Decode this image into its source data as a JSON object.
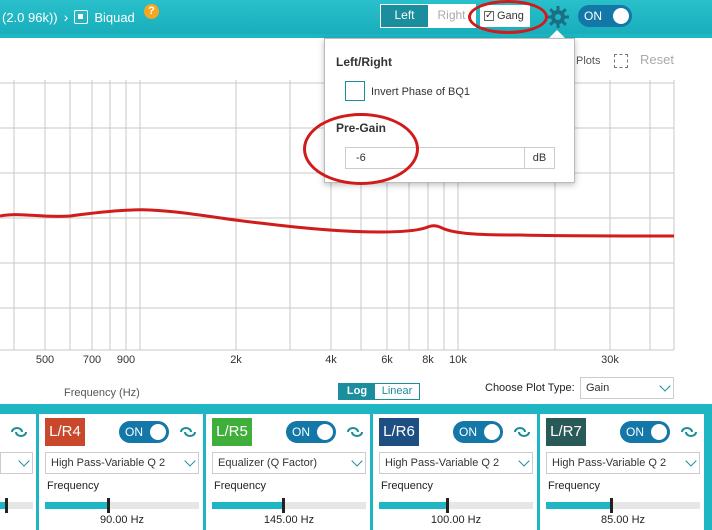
{
  "header": {
    "breadcrumb_prefix": "(2.0 96k))",
    "breadcrumb_sep": "›",
    "page": "Biquad",
    "help": "?",
    "left_label": "Left",
    "right_label": "Right",
    "gang_label": "Gang",
    "gang_check": "✓",
    "power_label": "ON"
  },
  "graph": {
    "plots_label": "Plots",
    "reset_label": "Reset",
    "x_ticks": [
      "500",
      "700",
      "900",
      "2k",
      "4k",
      "6k",
      "8k",
      "10k",
      "30k"
    ],
    "xlabel": "Frequency (Hz)",
    "scale_log": "Log",
    "scale_linear": "Linear",
    "plot_type_label": "Choose Plot Type:",
    "plot_type_value": "Gain",
    "curve_color": "#d01c1c"
  },
  "popup": {
    "section1": "Left/Right",
    "invert_label": "Invert Phase of BQ1",
    "section2": "Pre-Gain",
    "pregain_value": "-6",
    "pregain_unit": "dB"
  },
  "panels": [
    {
      "id": "L/R4",
      "color": "#c9472b",
      "toggle": "ON",
      "filter": "High Pass-Variable Q 2",
      "freq_label": "Frequency",
      "value": "90.00 Hz",
      "slider_level": 0.4
    },
    {
      "id": "L/R5",
      "color": "#3fae3b",
      "toggle": "ON",
      "filter": "Equalizer (Q Factor)",
      "freq_label": "Frequency",
      "value": "145.00 Hz",
      "slider_level": 0.45
    },
    {
      "id": "L/R6",
      "color": "#1e4f82",
      "toggle": "ON",
      "filter": "High Pass-Variable Q 2",
      "freq_label": "Frequency",
      "value": "100.00 Hz",
      "slider_level": 0.44
    },
    {
      "id": "L/R7",
      "color": "#2a5a58",
      "toggle": "ON",
      "filter": "High Pass-Variable Q 2",
      "freq_label": "Frequency",
      "value": "85.00 Hz",
      "slider_level": 0.42
    }
  ]
}
